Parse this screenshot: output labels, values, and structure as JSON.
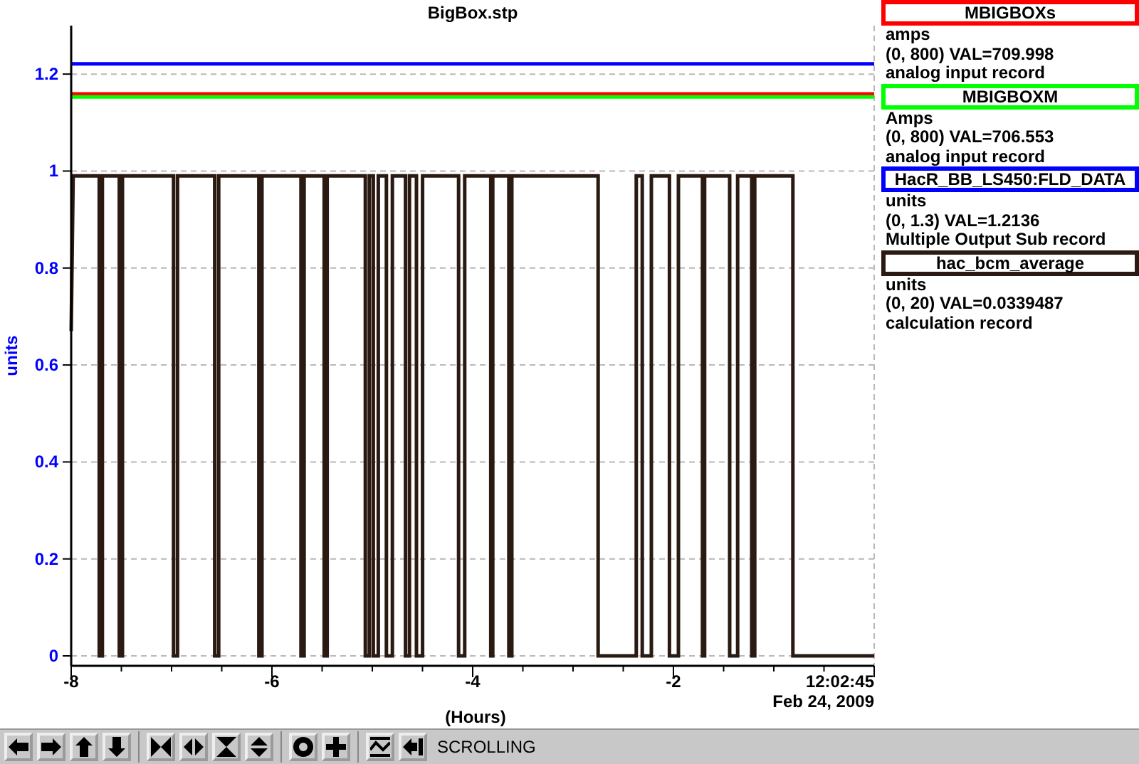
{
  "plot": {
    "chart_data": {
      "type": "line",
      "title": "BigBox.stp",
      "xlabel": "(Hours)",
      "ylabel": "units",
      "xlim": [
        -8,
        0
      ],
      "ylim": [
        0,
        1.3
      ],
      "xticks": [
        -8,
        -6,
        -4,
        -2
      ],
      "grid": true,
      "yticks": [
        {
          "value": 0,
          "label": "0"
        },
        {
          "value": 0.2,
          "label": "0.2"
        },
        {
          "value": 0.4,
          "label": "0.4"
        },
        {
          "value": 0.6,
          "label": "0.6"
        },
        {
          "value": 0.8,
          "label": "0.8"
        },
        {
          "value": 1,
          "label": "1"
        },
        {
          "value": 1.2,
          "label": "1.2"
        }
      ],
      "series": [
        {
          "name": "MBIGBOXs",
          "color": "#ff0000",
          "x": [
            -8,
            0
          ],
          "values": [
            1.159,
            1.159
          ]
        },
        {
          "name": "MBIGBOXM",
          "color": "#00ff00",
          "x": [
            -8,
            0
          ],
          "values": [
            1.153,
            1.153
          ]
        },
        {
          "name": "HacR_BB_LS450:FLD_DATA",
          "color": "#0000ff",
          "x": [
            -8,
            0
          ],
          "values": [
            1.221,
            1.221
          ]
        },
        {
          "name": "hac_bcm_average",
          "color": "#2b1a12",
          "x": [
            -8,
            -7.98,
            -7.72,
            -7.72,
            -7.69,
            -7.69,
            -7.52,
            -7.52,
            -7.49,
            -7.49,
            -6.98,
            -6.98,
            -6.94,
            -6.94,
            -6.57,
            -6.57,
            -6.53,
            -6.53,
            -6.13,
            -6.13,
            -6.1,
            -6.1,
            -5.71,
            -5.71,
            -5.68,
            -5.68,
            -5.48,
            -5.48,
            -5.45,
            -5.45,
            -5.07,
            -5.07,
            -5.03,
            -5.03,
            -4.99,
            -4.99,
            -4.94,
            -4.94,
            -4.86,
            -4.86,
            -4.8,
            -4.8,
            -4.67,
            -4.67,
            -4.63,
            -4.63,
            -4.56,
            -4.56,
            -4.5,
            -4.5,
            -4.14,
            -4.14,
            -4.08,
            -4.08,
            -3.82,
            -3.82,
            -3.8,
            -3.8,
            -3.64,
            -3.64,
            -3.61,
            -3.61,
            -2.75,
            -2.75,
            -2.37,
            -2.37,
            -2.31,
            -2.31,
            -2.22,
            -2.22,
            -2.04,
            -2.04,
            -1.95,
            -1.95,
            -1.71,
            -1.71,
            -1.69,
            -1.69,
            -1.44,
            -1.44,
            -1.36,
            -1.36,
            -1.22,
            -1.22,
            -1.19,
            -1.19,
            -0.81,
            -0.81,
            0
          ],
          "values": [
            0.67,
            0.99,
            0.99,
            0,
            0,
            0.99,
            0.99,
            0,
            0,
            0.99,
            0.99,
            0,
            0,
            0.99,
            0.99,
            0,
            0,
            0.99,
            0.99,
            0,
            0,
            0.99,
            0.99,
            0,
            0,
            0.99,
            0.99,
            0,
            0,
            0.99,
            0.99,
            0,
            0,
            0.99,
            0.99,
            0,
            0,
            0.99,
            0.99,
            0,
            0,
            0.99,
            0.99,
            0,
            0,
            0.99,
            0.99,
            0,
            0,
            0.99,
            0.99,
            0,
            0,
            0.99,
            0.99,
            0,
            0,
            0.99,
            0.99,
            0,
            0,
            0.99,
            0.99,
            0,
            0,
            0.99,
            0.99,
            0,
            0,
            0.99,
            0.99,
            0,
            0,
            0.99,
            0.99,
            0,
            0,
            0.99,
            0.99,
            0,
            0,
            0.99,
            0.99,
            0,
            0,
            0.99,
            0.99,
            0,
            0
          ]
        }
      ]
    },
    "timestamp": [
      "12:02:45",
      "Feb 24, 2009"
    ]
  },
  "legend": [
    {
      "units": "amps",
      "reading": "(0, 800) VAL=709.998",
      "record_type": "analog input record"
    },
    {
      "units": "Amps",
      "reading": "(0, 800) VAL=706.553",
      "record_type": "analog input record"
    },
    {
      "units": "units",
      "reading": "(0, 1.3) VAL=1.2136",
      "record_type": "Multiple Output Sub record"
    },
    {
      "units": "units",
      "reading": "(0, 20) VAL=0.0339487",
      "record_type": "calculation record"
    }
  ],
  "toolbar": {
    "mode": "SCROLLING"
  }
}
